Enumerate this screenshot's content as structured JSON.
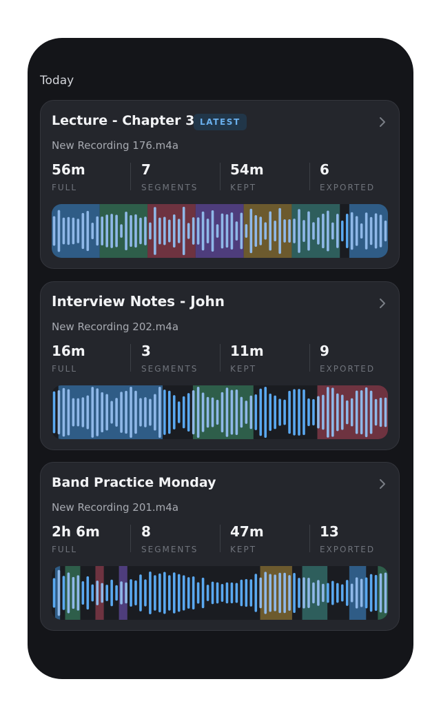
{
  "section_title": "Today",
  "recordings": [
    {
      "title": "Lecture - Chapter 3",
      "badge": "LATEST",
      "filename": "New Recording 176.m4a",
      "stats": [
        {
          "value": "56m",
          "label": "FULL"
        },
        {
          "value": "7",
          "label": "SEGMENTS"
        },
        {
          "value": "54m",
          "label": "KEPT"
        },
        {
          "value": "6",
          "label": "EXPORTED"
        }
      ],
      "segments": [
        {
          "start": 0.0,
          "end": 0.143,
          "color": "#2f5c86"
        },
        {
          "start": 0.143,
          "end": 0.285,
          "color": "#2e5e4a"
        },
        {
          "start": 0.285,
          "end": 0.428,
          "color": "#6e3340"
        },
        {
          "start": 0.428,
          "end": 0.571,
          "color": "#4e3d7c"
        },
        {
          "start": 0.571,
          "end": 0.714,
          "color": "#6c5a2e"
        },
        {
          "start": 0.714,
          "end": 0.857,
          "color": "#2e5e5c"
        },
        {
          "start": 0.885,
          "end": 1.0,
          "color": "#2f5c86"
        }
      ]
    },
    {
      "title": "Interview Notes - John",
      "badge": "",
      "filename": "New Recording 202.m4a",
      "stats": [
        {
          "value": "16m",
          "label": "FULL"
        },
        {
          "value": "3",
          "label": "SEGMENTS"
        },
        {
          "value": "11m",
          "label": "KEPT"
        },
        {
          "value": "9",
          "label": "EXPORTED"
        }
      ],
      "segments": [
        {
          "start": 0.02,
          "end": 0.33,
          "color": "#2f5c86"
        },
        {
          "start": 0.42,
          "end": 0.6,
          "color": "#2e5e4a"
        },
        {
          "start": 0.79,
          "end": 1.0,
          "color": "#6e3340"
        }
      ]
    },
    {
      "title": "Band Practice Monday",
      "badge": "",
      "filename": "New Recording 201.m4a",
      "stats": [
        {
          "value": "2h 6m",
          "label": "FULL"
        },
        {
          "value": "8",
          "label": "SEGMENTS"
        },
        {
          "value": "47m",
          "label": "KEPT"
        },
        {
          "value": "13",
          "label": "EXPORTED"
        }
      ],
      "segments": [
        {
          "start": 0.01,
          "end": 0.025,
          "color": "#2f5c86"
        },
        {
          "start": 0.04,
          "end": 0.085,
          "color": "#2e5e4a"
        },
        {
          "start": 0.13,
          "end": 0.155,
          "color": "#6e3340"
        },
        {
          "start": 0.2,
          "end": 0.225,
          "color": "#4e3d7c"
        },
        {
          "start": 0.62,
          "end": 0.715,
          "color": "#6c5a2e"
        },
        {
          "start": 0.745,
          "end": 0.82,
          "color": "#2e5e5c"
        },
        {
          "start": 0.885,
          "end": 0.935,
          "color": "#2f5c86"
        },
        {
          "start": 0.97,
          "end": 1.0,
          "color": "#2e5e4a"
        }
      ]
    }
  ],
  "colors": {
    "bar_default": "#5aa8f0",
    "bar_in_segment": "#8fb8e8",
    "wave_bg": "#1a1c21",
    "accent": "#6ab0ee"
  }
}
